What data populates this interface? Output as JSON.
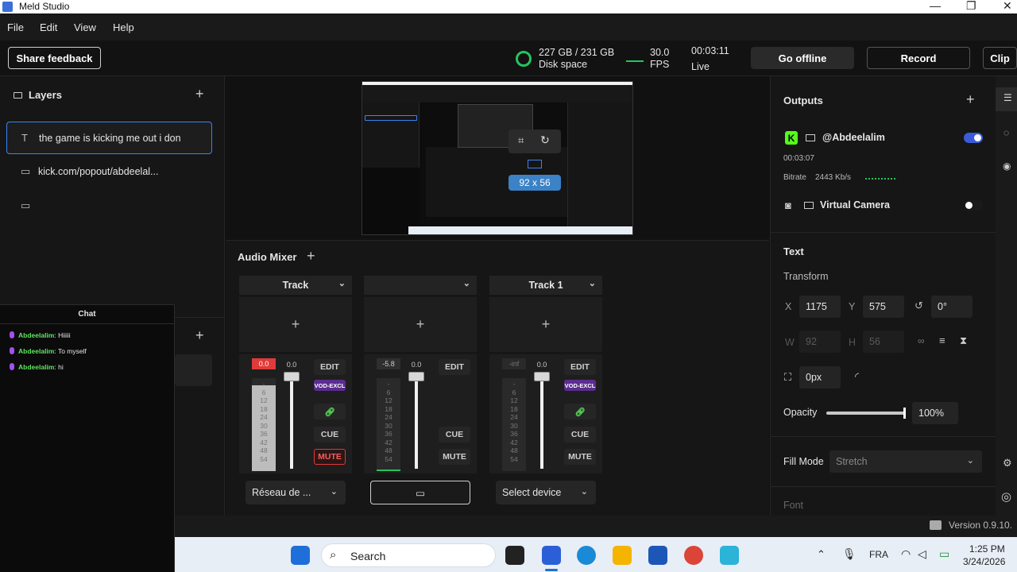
{
  "window": {
    "title": "Meld Studio",
    "controls": [
      "—",
      "❐",
      "✕"
    ]
  },
  "menu": [
    "File",
    "Edit",
    "View",
    "Help"
  ],
  "toolbar": {
    "share_feedback": "Share feedback",
    "disk": "227 GB / 231 GB",
    "disk_label": "Disk space",
    "fps": "30.0",
    "fps_label": "FPS",
    "time": "00:03:11",
    "live_label": "Live",
    "go_offline": "Go offline",
    "record": "Record",
    "clip": "Clip"
  },
  "layers": {
    "title": "Layers",
    "add": "+",
    "items": [
      {
        "icon": "text-icon",
        "glyph": "T",
        "label": "the game is kicking me out i don"
      },
      {
        "icon": "monitor-icon",
        "glyph": "▭",
        "label": "kick.com/popout/abdeelal..."
      },
      {
        "icon": "monitor-icon",
        "glyph": "▭",
        "label": ""
      }
    ],
    "second_add": "+"
  },
  "chat": {
    "title": "Chat",
    "messages": [
      {
        "user": "Abdeelalim",
        "text": "Hiiiii"
      },
      {
        "user": "Abdeelalim",
        "text": "To myself"
      },
      {
        "user": "Abdeelalim",
        "text": "hi"
      }
    ]
  },
  "preview": {
    "size_badge": "92 x 56"
  },
  "mixer": {
    "title": "Audio Mixer",
    "add": "+",
    "strips": [
      {
        "name": "Track",
        "level": "0.0",
        "fader": "0.0",
        "edit": "EDIT",
        "vod": "VOD-EXCL",
        "cue": "CUE",
        "mute": "MUTE",
        "muted": true,
        "device": "Réseau de ...",
        "meter_fill": 0.92
      },
      {
        "name": "",
        "level": "-5.8",
        "fader": "0.0",
        "edit": "EDIT",
        "vod": "",
        "cue": "CUE",
        "mute": "MUTE",
        "muted": false,
        "device": "",
        "meter_fill": 0.02
      },
      {
        "name": "Track 1",
        "level": "-inf",
        "fader": "0.0",
        "edit": "EDIT",
        "vod": "VOD-EXCL",
        "cue": "CUE",
        "mute": "MUTE",
        "muted": false,
        "device": "Select device",
        "meter_fill": 0.0
      }
    ],
    "scale": [
      "0",
      "6",
      "12",
      "18",
      "24",
      "30",
      "36",
      "42",
      "48",
      "54"
    ],
    "scale_marks": [
      "-",
      "-",
      "-",
      "-",
      "-",
      "-",
      "-",
      "-",
      "-",
      "-"
    ]
  },
  "outputs": {
    "title": "Outputs",
    "add": "+",
    "channel": "@Abdeelalim",
    "channel_time": "00:03:07",
    "bitrate_label": "Bitrate",
    "bitrate": "2443 Kb/s",
    "channel_enabled": true,
    "virtual_camera": "Virtual Camera",
    "virtual_enabled": false
  },
  "properties": {
    "section": "Text",
    "transform": "Transform",
    "x_label": "X",
    "x": "1175",
    "y_label": "Y",
    "y": "575",
    "rotation": "0°",
    "w_label": "W",
    "w": "92",
    "h_label": "H",
    "h": "56",
    "corner": "0px",
    "opacity_label": "Opacity",
    "opacity": "100%",
    "opacity_value": 1.0,
    "fill_mode_label": "Fill Mode",
    "fill_mode": "Stretch",
    "font_label": "Font"
  },
  "statusbar": {
    "version": "Version 0.9.10."
  },
  "taskbar": {
    "search": "Search",
    "lang": "FRA",
    "time": "1:25 PM",
    "date": "3/24/2026"
  },
  "colors": {
    "accent": "#3b5bdb",
    "live_green": "#22c55e",
    "mute_red": "#e03a3a",
    "kick_green": "#53fc18",
    "chat_user": "#5ee65e"
  }
}
